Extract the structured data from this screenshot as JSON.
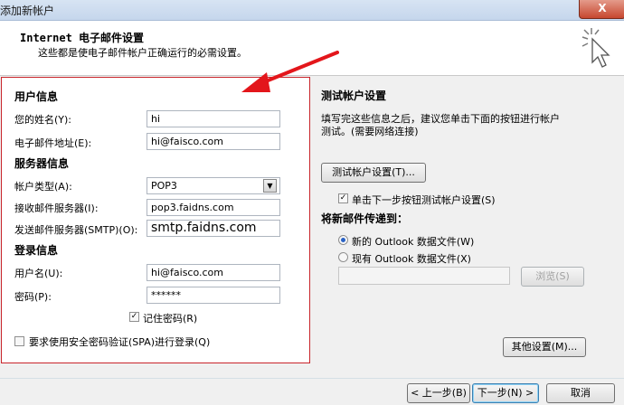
{
  "window": {
    "title": "添加新帐户",
    "close_label": "X"
  },
  "header": {
    "title": "Internet 电子邮件设置",
    "subtitle": "这些都是使电子邮件帐户正确运行的必需设置。"
  },
  "user_info": {
    "section": "用户信息",
    "name_label": "您的姓名(Y):",
    "name_value": "hi",
    "email_label": "电子邮件地址(E):",
    "email_value": "hi@faisco.com"
  },
  "server_info": {
    "section": "服务器信息",
    "account_type_label": "帐户类型(A):",
    "account_type_value": "POP3",
    "incoming_label": "接收邮件服务器(I):",
    "incoming_value": "pop3.faidns.com",
    "outgoing_label": "发送邮件服务器(SMTP)(O):",
    "outgoing_value": "smtp.faidns.com"
  },
  "login_info": {
    "section": "登录信息",
    "username_label": "用户名(U):",
    "username_value": "hi@faisco.com",
    "password_label": "密码(P):",
    "password_value": "******",
    "remember_label": "记住密码(R)",
    "spa_label": "要求使用安全密码验证(SPA)进行登录(Q)"
  },
  "test": {
    "section": "测试帐户设置",
    "description_line1": "填写完这些信息之后，建议您单击下面的按钮进行帐户",
    "description_line2": "测试。(需要网络连接)",
    "test_button": "测试帐户设置(T)...",
    "auto_test_label": "单击下一步按钮测试帐户设置(S)"
  },
  "deliver": {
    "section": "将新邮件传递到：",
    "new_file_label": "新的 Outlook 数据文件(W)",
    "existing_file_label": "现有 Outlook 数据文件(X)",
    "browse_button": "浏览(S)"
  },
  "buttons": {
    "more_settings": "其他设置(M)...",
    "back": "< 上一步(B)",
    "next": "下一步(N) >",
    "cancel": "取消"
  }
}
